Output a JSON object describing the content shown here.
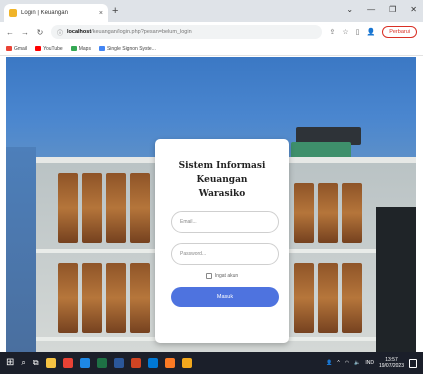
{
  "browser": {
    "tab_title": "Login | Keuangan",
    "tab_close": "×",
    "new_tab": "+",
    "window_controls": [
      "⌄",
      "—",
      "❐",
      "✕"
    ],
    "url_host": "localhost",
    "url_path": "/keuangan/login.php?pesan=belum_login",
    "profile_label": "Perbarui",
    "bookmarks": [
      {
        "label": "Gmail",
        "color": "#ea4335"
      },
      {
        "label": "YouTube",
        "color": "#ff0000"
      },
      {
        "label": "Maps",
        "color": "#34a853"
      },
      {
        "label": "Single Signon Syste...",
        "color": "#4285f4"
      }
    ]
  },
  "login": {
    "title_line1": "Sistem Informasi Keuangan",
    "title_line2": "Warasiko",
    "email_placeholder": "Email...",
    "password_placeholder": "Password...",
    "remember_label": "Ingat akun",
    "submit_label": "Masuk",
    "accent_color": "#4e73df"
  },
  "taskbar": {
    "time": "13:57",
    "date": "19/07/2023",
    "tray_lang": "IND",
    "app_icons": [
      {
        "name": "file-explorer-icon",
        "color": "#f6c343"
      },
      {
        "name": "chrome-icon",
        "color": "#e94235"
      },
      {
        "name": "mail-icon",
        "color": "#1e88e5"
      },
      {
        "name": "excel-icon",
        "color": "#1e7145"
      },
      {
        "name": "word-icon",
        "color": "#2b579a"
      },
      {
        "name": "powerpoint-icon",
        "color": "#d04423"
      },
      {
        "name": "store-icon",
        "color": "#0078d4"
      },
      {
        "name": "xampp-icon",
        "color": "#fb7a24"
      },
      {
        "name": "media-icon",
        "color": "#f2a81d"
      }
    ]
  }
}
